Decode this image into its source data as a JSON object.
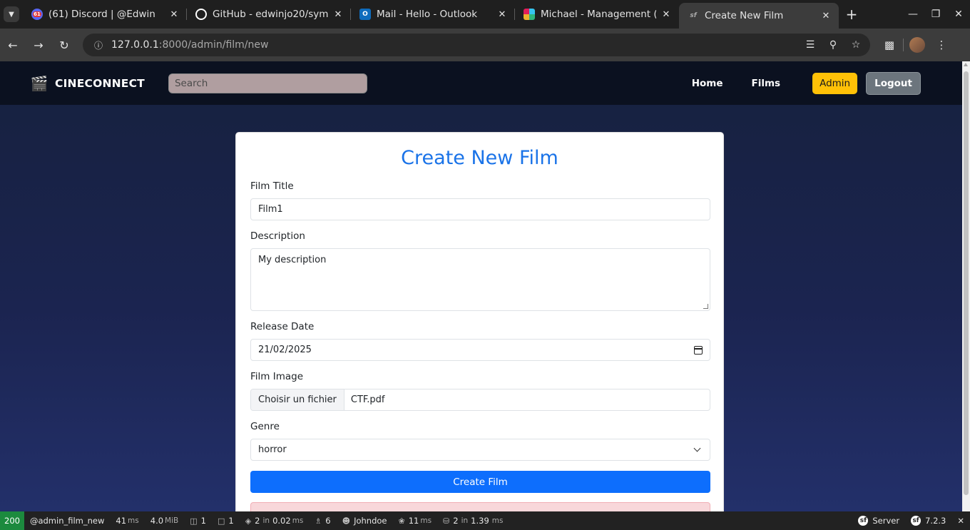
{
  "browser": {
    "tabs": [
      {
        "title": "(61) Discord | @Edwin",
        "icon": "discord-icon",
        "badge": "61",
        "color": "#5865f2"
      },
      {
        "title": "GitHub - edwinjo20/symf",
        "icon": "github-icon",
        "color": "#ffffff"
      },
      {
        "title": "Mail - Hello - Outlook",
        "icon": "outlook-icon",
        "color": "#0f6cbd"
      },
      {
        "title": "Michael - Management (",
        "icon": "slack-icon",
        "color": "#e01e5a"
      },
      {
        "title": "Create New Film",
        "icon": "symfony-icon",
        "active": true
      }
    ],
    "url_host": "127.0.0.1",
    "url_rest": ":8000/admin/film/new"
  },
  "site": {
    "brand": "CINECONNECT",
    "search_placeholder": "Search",
    "nav": {
      "home": "Home",
      "films": "Films",
      "admin": "Admin",
      "logout": "Logout"
    },
    "colors": {
      "admin": "#ffc107",
      "logout": "#6c757d",
      "primary": "#0d6efd",
      "heading": "#1a73e8"
    }
  },
  "form": {
    "heading": "Create New Film",
    "title_label": "Film Title",
    "title_value": "Film1",
    "description_label": "Description",
    "description_value": "My description",
    "release_label": "Release Date",
    "release_value": "21/02/2025",
    "image_label": "Film Image",
    "image_button": "Choisir un fichier",
    "image_value": "CTF.pdf",
    "genre_label": "Genre",
    "genre_value": "horror",
    "submit": "Create Film"
  },
  "profiler": {
    "status": "200",
    "route": "@admin_film_new",
    "time_value": "41",
    "time_unit": "ms",
    "memory_value": "4.0",
    "memory_unit": "MiB",
    "forms": "1",
    "requests": "1",
    "cache_value": "2",
    "cache_in": "in",
    "cache_time": "0.02",
    "cache_unit": "ms",
    "translations": "6",
    "user": "Johndoe",
    "twig_value": "11",
    "twig_unit": "ms",
    "db_value": "2",
    "db_in": "in",
    "db_time": "1.39",
    "db_unit": "ms",
    "server": "Server",
    "version": "7.2.3"
  }
}
